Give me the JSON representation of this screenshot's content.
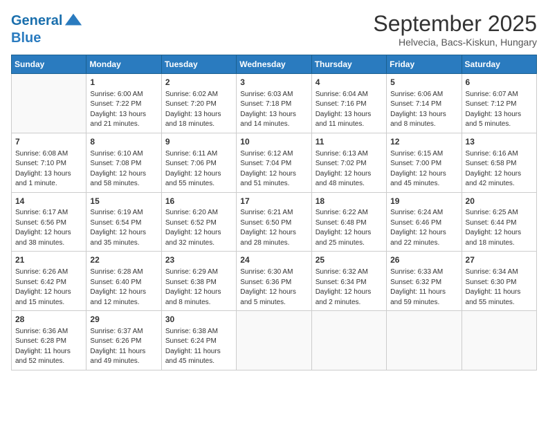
{
  "header": {
    "logo_line1": "General",
    "logo_line2": "Blue",
    "month": "September 2025",
    "location": "Helvecia, Bacs-Kiskun, Hungary"
  },
  "days_of_week": [
    "Sunday",
    "Monday",
    "Tuesday",
    "Wednesday",
    "Thursday",
    "Friday",
    "Saturday"
  ],
  "weeks": [
    [
      {
        "day": "",
        "info": ""
      },
      {
        "day": "1",
        "info": "Sunrise: 6:00 AM\nSunset: 7:22 PM\nDaylight: 13 hours and 21 minutes."
      },
      {
        "day": "2",
        "info": "Sunrise: 6:02 AM\nSunset: 7:20 PM\nDaylight: 13 hours and 18 minutes."
      },
      {
        "day": "3",
        "info": "Sunrise: 6:03 AM\nSunset: 7:18 PM\nDaylight: 13 hours and 14 minutes."
      },
      {
        "day": "4",
        "info": "Sunrise: 6:04 AM\nSunset: 7:16 PM\nDaylight: 13 hours and 11 minutes."
      },
      {
        "day": "5",
        "info": "Sunrise: 6:06 AM\nSunset: 7:14 PM\nDaylight: 13 hours and 8 minutes."
      },
      {
        "day": "6",
        "info": "Sunrise: 6:07 AM\nSunset: 7:12 PM\nDaylight: 13 hours and 5 minutes."
      }
    ],
    [
      {
        "day": "7",
        "info": "Sunrise: 6:08 AM\nSunset: 7:10 PM\nDaylight: 13 hours and 1 minute."
      },
      {
        "day": "8",
        "info": "Sunrise: 6:10 AM\nSunset: 7:08 PM\nDaylight: 12 hours and 58 minutes."
      },
      {
        "day": "9",
        "info": "Sunrise: 6:11 AM\nSunset: 7:06 PM\nDaylight: 12 hours and 55 minutes."
      },
      {
        "day": "10",
        "info": "Sunrise: 6:12 AM\nSunset: 7:04 PM\nDaylight: 12 hours and 51 minutes."
      },
      {
        "day": "11",
        "info": "Sunrise: 6:13 AM\nSunset: 7:02 PM\nDaylight: 12 hours and 48 minutes."
      },
      {
        "day": "12",
        "info": "Sunrise: 6:15 AM\nSunset: 7:00 PM\nDaylight: 12 hours and 45 minutes."
      },
      {
        "day": "13",
        "info": "Sunrise: 6:16 AM\nSunset: 6:58 PM\nDaylight: 12 hours and 42 minutes."
      }
    ],
    [
      {
        "day": "14",
        "info": "Sunrise: 6:17 AM\nSunset: 6:56 PM\nDaylight: 12 hours and 38 minutes."
      },
      {
        "day": "15",
        "info": "Sunrise: 6:19 AM\nSunset: 6:54 PM\nDaylight: 12 hours and 35 minutes."
      },
      {
        "day": "16",
        "info": "Sunrise: 6:20 AM\nSunset: 6:52 PM\nDaylight: 12 hours and 32 minutes."
      },
      {
        "day": "17",
        "info": "Sunrise: 6:21 AM\nSunset: 6:50 PM\nDaylight: 12 hours and 28 minutes."
      },
      {
        "day": "18",
        "info": "Sunrise: 6:22 AM\nSunset: 6:48 PM\nDaylight: 12 hours and 25 minutes."
      },
      {
        "day": "19",
        "info": "Sunrise: 6:24 AM\nSunset: 6:46 PM\nDaylight: 12 hours and 22 minutes."
      },
      {
        "day": "20",
        "info": "Sunrise: 6:25 AM\nSunset: 6:44 PM\nDaylight: 12 hours and 18 minutes."
      }
    ],
    [
      {
        "day": "21",
        "info": "Sunrise: 6:26 AM\nSunset: 6:42 PM\nDaylight: 12 hours and 15 minutes."
      },
      {
        "day": "22",
        "info": "Sunrise: 6:28 AM\nSunset: 6:40 PM\nDaylight: 12 hours and 12 minutes."
      },
      {
        "day": "23",
        "info": "Sunrise: 6:29 AM\nSunset: 6:38 PM\nDaylight: 12 hours and 8 minutes."
      },
      {
        "day": "24",
        "info": "Sunrise: 6:30 AM\nSunset: 6:36 PM\nDaylight: 12 hours and 5 minutes."
      },
      {
        "day": "25",
        "info": "Sunrise: 6:32 AM\nSunset: 6:34 PM\nDaylight: 12 hours and 2 minutes."
      },
      {
        "day": "26",
        "info": "Sunrise: 6:33 AM\nSunset: 6:32 PM\nDaylight: 11 hours and 59 minutes."
      },
      {
        "day": "27",
        "info": "Sunrise: 6:34 AM\nSunset: 6:30 PM\nDaylight: 11 hours and 55 minutes."
      }
    ],
    [
      {
        "day": "28",
        "info": "Sunrise: 6:36 AM\nSunset: 6:28 PM\nDaylight: 11 hours and 52 minutes."
      },
      {
        "day": "29",
        "info": "Sunrise: 6:37 AM\nSunset: 6:26 PM\nDaylight: 11 hours and 49 minutes."
      },
      {
        "day": "30",
        "info": "Sunrise: 6:38 AM\nSunset: 6:24 PM\nDaylight: 11 hours and 45 minutes."
      },
      {
        "day": "",
        "info": ""
      },
      {
        "day": "",
        "info": ""
      },
      {
        "day": "",
        "info": ""
      },
      {
        "day": "",
        "info": ""
      }
    ]
  ]
}
